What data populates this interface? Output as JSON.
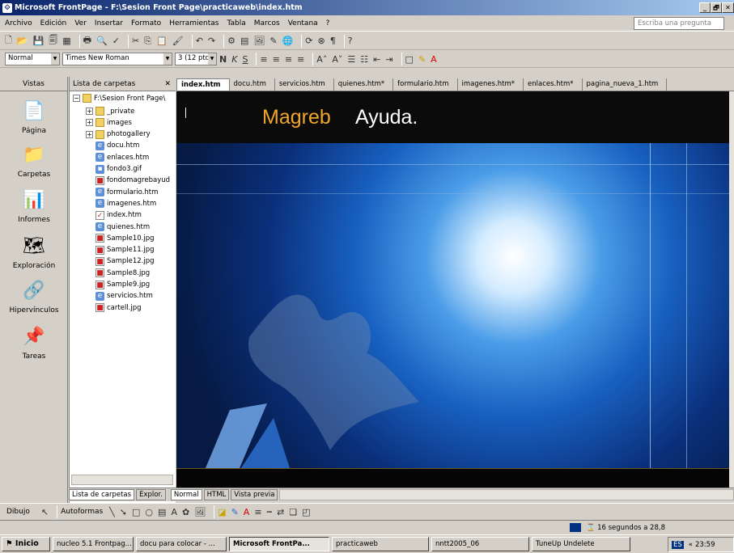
{
  "window": {
    "title": "Microsoft FrontPage - F:\\Sesion Front Page\\practicaweb\\index.htm",
    "controls": [
      "_",
      "🗗",
      "✕"
    ]
  },
  "menu": {
    "items": [
      "Archivo",
      "Edición",
      "Ver",
      "Insertar",
      "Formato",
      "Herramientas",
      "Tabla",
      "Marcos",
      "Ventana",
      "?"
    ],
    "ask_placeholder": "Escriba una pregunta"
  },
  "format": {
    "style": "Normal",
    "font": "Times New Roman",
    "size": "3 (12 pto"
  },
  "views": {
    "header": "Vistas",
    "items": [
      "Página",
      "Carpetas",
      "Informes",
      "Exploración",
      "Hipervínculos",
      "Tareas"
    ]
  },
  "folder": {
    "header": "Lista de carpetas",
    "root": "F:\\Sesion Front Page\\",
    "items": [
      {
        "name": "_private",
        "type": "folder",
        "exp": true
      },
      {
        "name": "images",
        "type": "folder",
        "exp": true
      },
      {
        "name": "photogallery",
        "type": "folder",
        "exp": true
      },
      {
        "name": "docu.htm",
        "type": "htm"
      },
      {
        "name": "enlaces.htm",
        "type": "htm"
      },
      {
        "name": "fondo3.gif",
        "type": "gif"
      },
      {
        "name": "fondomagrebayud",
        "type": "img"
      },
      {
        "name": "formulario.htm",
        "type": "htm"
      },
      {
        "name": "imagenes.htm",
        "type": "htm"
      },
      {
        "name": "index.htm",
        "type": "index"
      },
      {
        "name": "quienes.htm",
        "type": "htm"
      },
      {
        "name": "Sample10.jpg",
        "type": "img"
      },
      {
        "name": "Sample11.jpg",
        "type": "img"
      },
      {
        "name": "Sample12.jpg",
        "type": "img"
      },
      {
        "name": "Sample8.jpg",
        "type": "img"
      },
      {
        "name": "Sample9.jpg",
        "type": "img"
      },
      {
        "name": "servicios.htm",
        "type": "htm"
      },
      {
        "name": "cartell.jpg",
        "type": "img"
      }
    ]
  },
  "tabs": [
    "index.htm",
    "docu.htm",
    "servicios.htm",
    "quienes.htm*",
    "formulario.htm",
    "imagenes.htm*",
    "enlaces.htm*",
    "pagina_nueva_1.htm"
  ],
  "page": {
    "title_orange": "Magreb",
    "title_white": "Ayuda."
  },
  "bottom_tabs": {
    "left": [
      "Lista de carpetas",
      "Explor."
    ],
    "views": [
      "Normal",
      "HTML",
      "Vista previa"
    ]
  },
  "drawing": {
    "dibujo": "Dibujo",
    "autoformas": "Autoformas"
  },
  "status": {
    "timer": "16 segundos a 28,8"
  },
  "taskbar": {
    "start": "Inicio",
    "tasks": [
      "nucleo 5.1 Frontpag...",
      "docu para colocar - ...",
      "Microsoft FrontPa...",
      "practicaweb",
      "nntt2005_06",
      "TuneUp Undelete"
    ],
    "lang": "ES",
    "time": "23:59"
  }
}
